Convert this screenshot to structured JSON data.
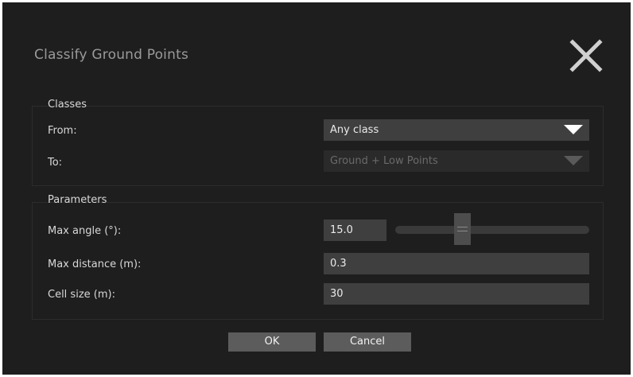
{
  "dialog": {
    "title": "Classify Ground Points",
    "close_icon": "close-icon"
  },
  "classes": {
    "legend": "Classes",
    "from_label": "From:",
    "from_value": "Any class",
    "to_label": "To:",
    "to_value": "Ground + Low Points"
  },
  "parameters": {
    "legend": "Parameters",
    "max_angle_label": "Max angle (°):",
    "max_angle_value": "15.0",
    "max_angle_slider_fraction": 0.3,
    "max_distance_label": "Max distance (m):",
    "max_distance_value": "0.3",
    "cell_size_label": "Cell size (m):",
    "cell_size_value": "30"
  },
  "buttons": {
    "ok": "OK",
    "cancel": "Cancel"
  },
  "colors": {
    "dialog_bg": "#1e1e1e",
    "field_bg": "#3f3f3f",
    "button_bg": "#5c5c5c"
  }
}
